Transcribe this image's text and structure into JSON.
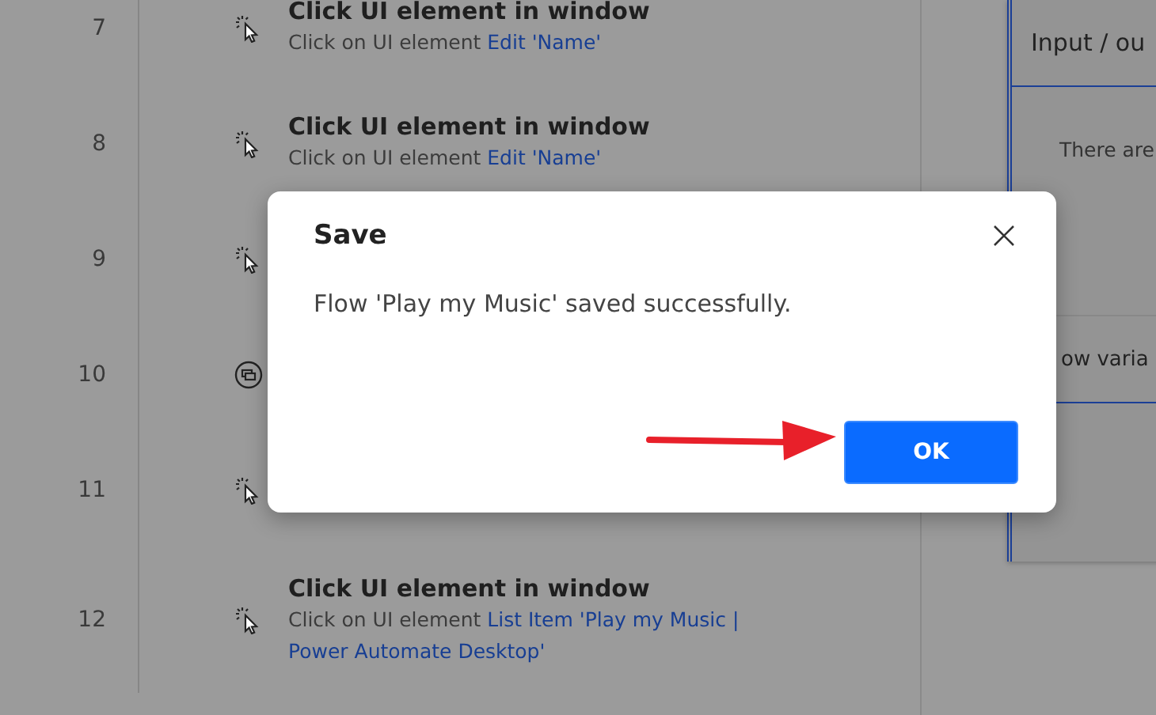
{
  "steps": [
    {
      "number": "7",
      "kind": "click",
      "title": "Click UI element in window",
      "detail": "Click on UI element",
      "target": "Edit 'Name'"
    },
    {
      "number": "8",
      "kind": "click",
      "title": "Click UI element in window",
      "detail": "Click on UI element",
      "target": "Edit 'Name'"
    },
    {
      "number": "9",
      "kind": "click"
    },
    {
      "number": "10",
      "kind": "subflow"
    },
    {
      "number": "11",
      "kind": "click"
    },
    {
      "number": "12",
      "kind": "click",
      "title": "Click UI element in window",
      "detail": "Click on UI element",
      "target": "List Item 'Play my Music | Power Automate Desktop'"
    }
  ],
  "side_panel": {
    "sections": [
      {
        "heading": "Input / ou",
        "body": "There are"
      },
      {
        "heading": "ow varia"
      }
    ]
  },
  "dialog": {
    "title": "Save",
    "message": "Flow 'Play my Music' saved successfully.",
    "buttons": [
      "OK"
    ]
  }
}
